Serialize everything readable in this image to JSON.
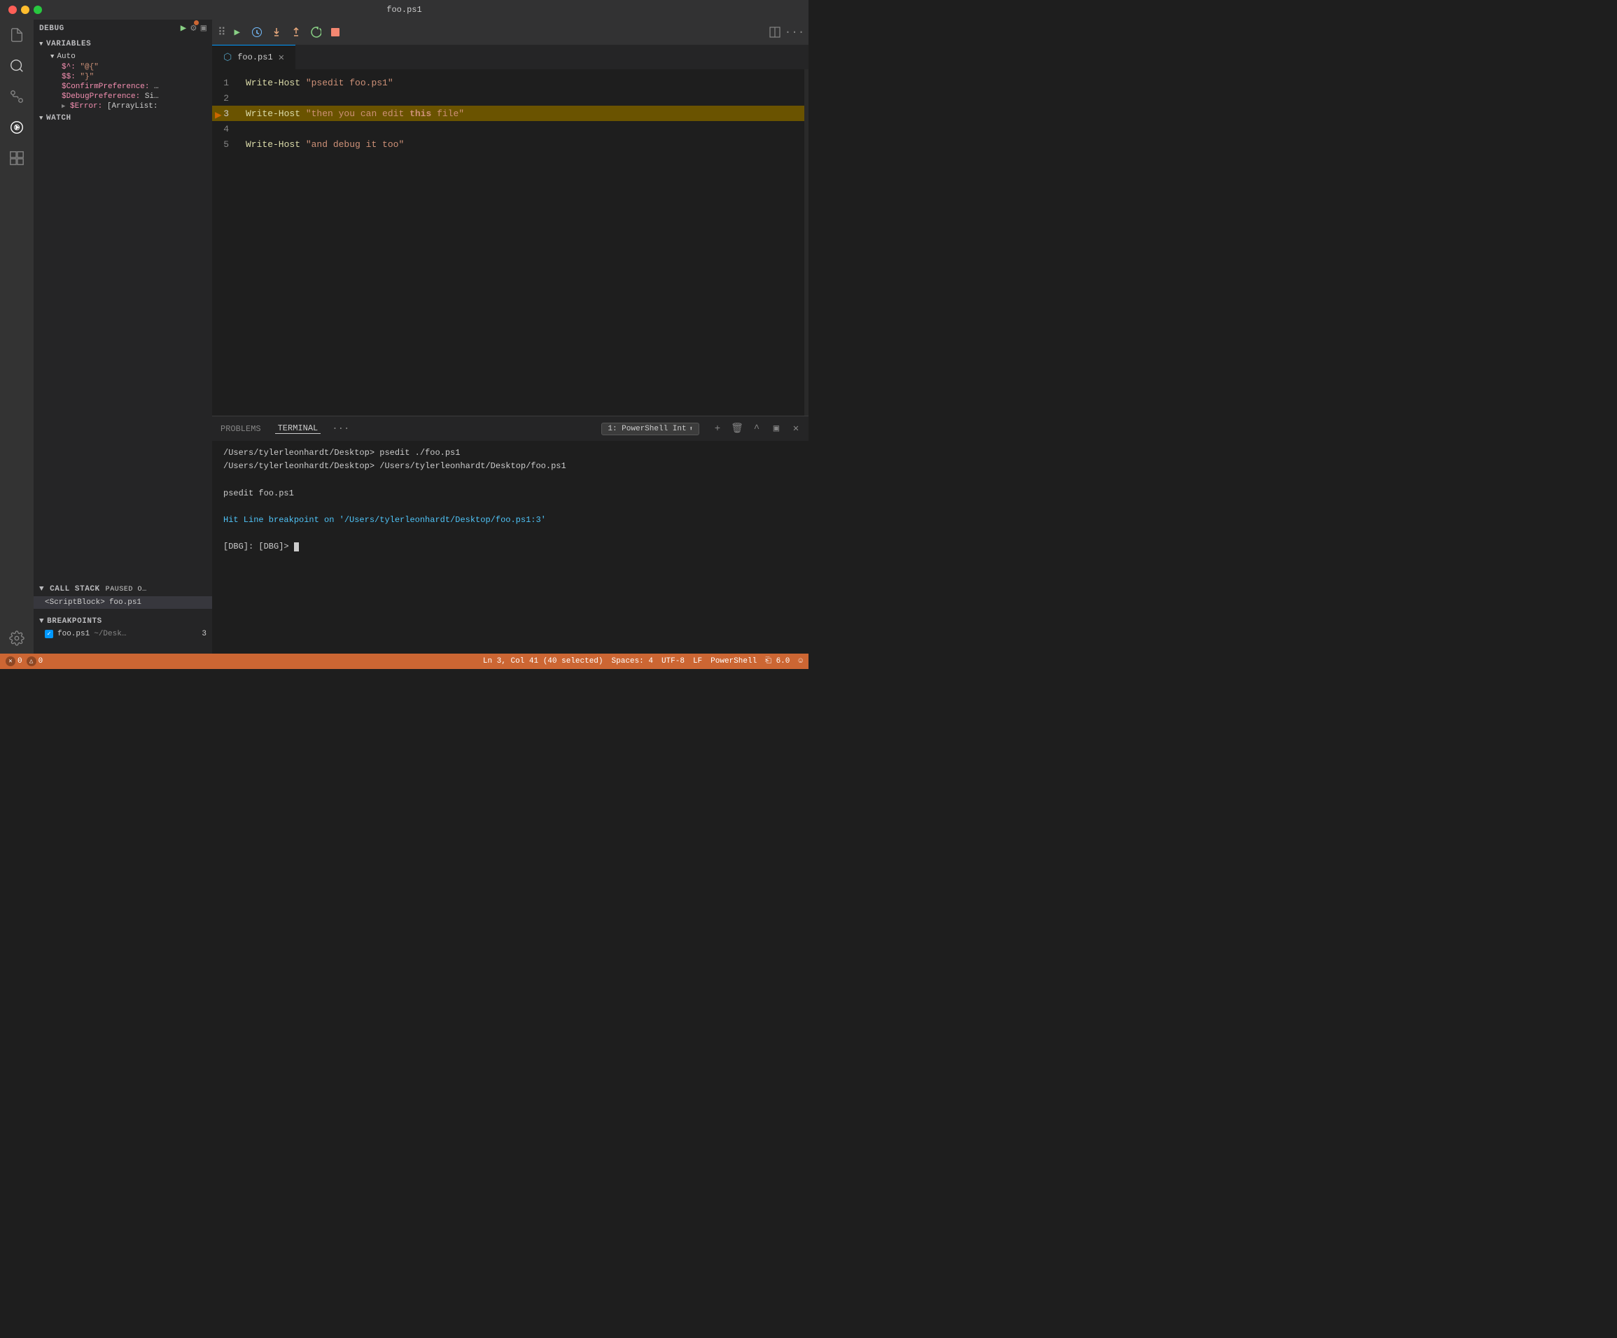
{
  "titlebar": {
    "title": "foo.ps1"
  },
  "activitybar": {
    "icons": [
      {
        "name": "files-icon",
        "symbol": "⎗",
        "active": false
      },
      {
        "name": "search-icon",
        "symbol": "🔍",
        "active": true
      },
      {
        "name": "source-control-icon",
        "symbol": "⑂",
        "active": false
      },
      {
        "name": "debug-icon",
        "symbol": "⦿",
        "active": true
      },
      {
        "name": "extensions-icon",
        "symbol": "⊞",
        "active": false
      },
      {
        "name": "gear-icon",
        "symbol": "⚙",
        "active": false
      }
    ]
  },
  "debug_panel": {
    "header_title": "DEBUG",
    "variables_label": "VARIABLES",
    "auto_label": "Auto",
    "variables": [
      {
        "name": "$^:",
        "value": "\"@{\""
      },
      {
        "name": "$$:",
        "value": "\"}\""
      },
      {
        "name": "$ConfirmPreference:",
        "value": "…"
      },
      {
        "name": "$DebugPreference:",
        "value": "Si…"
      },
      {
        "name": "$Error:",
        "value": "[ArrayList:"
      }
    ],
    "watch_label": "WATCH",
    "callstack_label": "CALL STACK",
    "callstack_badge": "PAUSED O…",
    "callstack_items": [
      {
        "func": "<ScriptBlock>",
        "file": "foo.ps1"
      }
    ],
    "breakpoints_label": "BREAKPOINTS",
    "breakpoints": [
      {
        "file": "foo.ps1",
        "path": "~/Desk…",
        "line": "3"
      }
    ]
  },
  "editor": {
    "tab_name": "foo.ps1",
    "lines": [
      {
        "num": "1",
        "content": "Write-Host \"psedit foo.ps1\"",
        "highlight": false
      },
      {
        "num": "2",
        "content": "",
        "highlight": false
      },
      {
        "num": "3",
        "content": "Write-Host \"then you can edit this file\"",
        "highlight": true,
        "breakpoint": true
      },
      {
        "num": "4",
        "content": "",
        "highlight": false
      },
      {
        "num": "5",
        "content": "Write-Host \"and debug it too\"",
        "highlight": false
      }
    ]
  },
  "terminal": {
    "tabs": [
      {
        "label": "PROBLEMS",
        "active": false
      },
      {
        "label": "TERMINAL",
        "active": true
      }
    ],
    "dropdown_label": "1: PowerShell Int",
    "lines": [
      {
        "text": "/Users/tylerleonhardt/Desktop> psedit ./foo.ps1",
        "class": "term-prompt"
      },
      {
        "text": "/Users/tylerleonhardt/Desktop> /Users/tylerleonhardt/Desktop/foo.ps1",
        "class": "term-prompt"
      },
      {
        "text": "",
        "class": ""
      },
      {
        "text": "psedit foo.ps1",
        "class": "term-prompt"
      },
      {
        "text": "",
        "class": ""
      },
      {
        "text": "Hit Line breakpoint on '/Users/tylerleonhardt/Desktop/foo.ps1:3'",
        "class": "term-blue"
      },
      {
        "text": "",
        "class": ""
      },
      {
        "text": "[DBG]:  [DBG]> ",
        "class": "term-prompt",
        "cursor": true
      }
    ]
  },
  "statusbar": {
    "errors": "0",
    "warnings": "0",
    "position": "Ln 3, Col 41 (40 selected)",
    "spaces": "Spaces: 4",
    "encoding": "UTF-8",
    "line_ending": "LF",
    "language": "PowerShell",
    "version": "⎗ 6.0",
    "smiley": "☺"
  }
}
